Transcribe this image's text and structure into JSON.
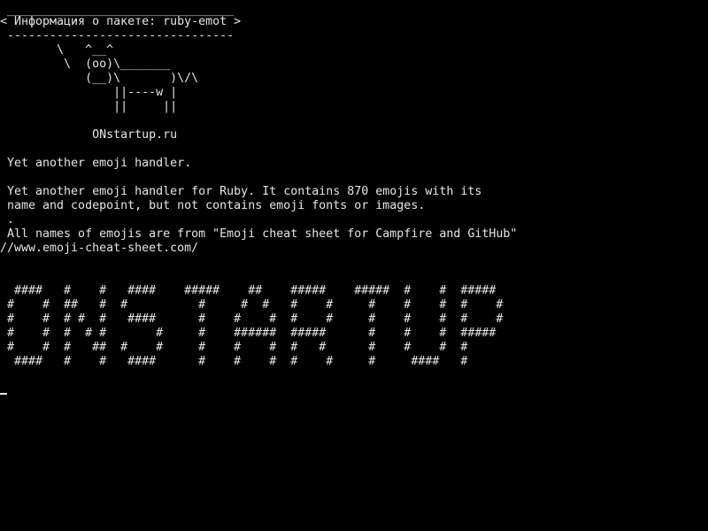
{
  "terminal": {
    "background": "#000000",
    "foreground": "#e6e6e6",
    "lines": [
      " ________________________________",
      "< Информация о пакете: ruby-emot >",
      " --------------------------------",
      "        \\   ^__^",
      "         \\  (oo)\\_______",
      "            (__)\\       )\\/\\",
      "                ||----w |",
      "                ||     ||",
      "",
      "             ONstartup.ru",
      "",
      " Yet another emoji handler.",
      "",
      " Yet another emoji handler for Ruby. It contains 870 emojis with its",
      " name and codepoint, but not contains emoji fonts or images.",
      " .",
      " All names of emojis are from \"Emoji cheat sheet for Campfire and GitHub\"",
      "//www.emoji-cheat-sheet.com/",
      "",
      "",
      "  ####   #    #   ####    #####    ##    #####    #####  #    #  #####",
      " #    #  ##   #  #          #     #  #   #    #     #    #    #  #    #",
      " #    #  # #  #   ####      #    #    #  #    #     #    #    #  #    #",
      " #    #  #  # #       #     #    ######  #####      #    #    #  #####",
      " #    #  #   ##  #    #     #    #    #  #   #      #    #    #  #",
      "  ####   #    #   ####      #    #    #  #    #     #     ####   #"
    ]
  }
}
